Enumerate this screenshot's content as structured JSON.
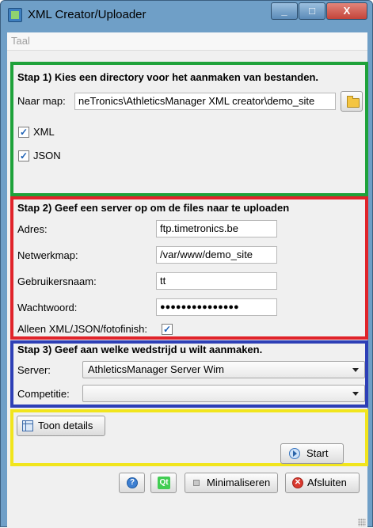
{
  "window": {
    "title": "XML Creator/Uploader"
  },
  "menu": {
    "items": [
      "Taal"
    ]
  },
  "step1": {
    "title": "Stap 1) Kies een directory voor het aanmaken van bestanden.",
    "folder_label": "Naar map:",
    "folder_value": "neTronics\\AthleticsManager XML creator\\demo_site",
    "xml_label": "XML",
    "xml_checked": true,
    "json_label": "JSON",
    "json_checked": true
  },
  "step2": {
    "title": "Stap 2) Geef een server op om de files naar te uploaden",
    "address_label": "Adres:",
    "address_value": "ftp.timetronics.be",
    "folder_label": "Netwerkmap:",
    "folder_value": "/var/www/demo_site",
    "user_label": "Gebruikersnaam:",
    "user_value": "tt",
    "password_label": "Wachtwoord:",
    "password_value": "●●●●●●●●●●●●●●●",
    "only_label": "Alleen XML/JSON/fotofinish:",
    "only_checked": true
  },
  "step3": {
    "title": "Stap 3) Geef aan welke wedstrijd u wilt aanmaken.",
    "server_label": "Server:",
    "server_value": "AthleticsManager Server Wim",
    "competition_label": "Competitie:",
    "competition_value": ""
  },
  "details": {
    "button_label": "Toon details"
  },
  "actions": {
    "start_label": "Start",
    "minimize_label": "Minimaliseren",
    "close_label": "Afsluiten",
    "qt_label": "Qt",
    "help_glyph": "?"
  },
  "colors": {
    "group1_border": "#1ea23a",
    "group2_border": "#e0232a",
    "group3_border": "#2d3fb6",
    "group4_border": "#f1e51d",
    "titlebar": "#6f9fc7"
  },
  "icons": [
    "app-icon",
    "folder-icon",
    "table-icon",
    "play-icon",
    "help-icon",
    "qt-icon",
    "minimize-icon",
    "close-icon"
  ]
}
